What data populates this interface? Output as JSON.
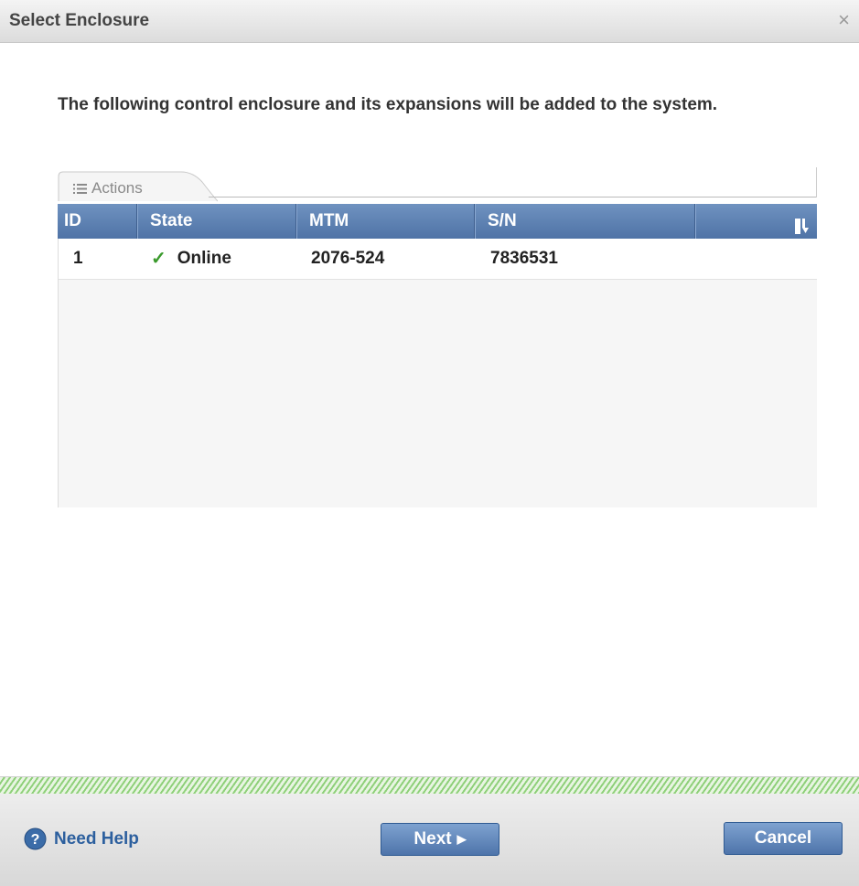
{
  "dialog": {
    "title": "Select Enclosure",
    "close_label": "×"
  },
  "intro_text": "The following control enclosure and its expansions will be added to the system.",
  "grid": {
    "actions_label": "Actions",
    "columns": [
      "ID",
      "State",
      "MTM",
      "S/N",
      ""
    ],
    "rows": [
      {
        "id": "1",
        "state": "Online",
        "state_icon": "check-icon",
        "mtm": "2076-524",
        "sn": "7836531"
      }
    ]
  },
  "footer": {
    "help_label": "Need Help",
    "next_label": "Next",
    "next_glyph": "▶",
    "cancel_label": "Cancel"
  },
  "colors": {
    "header_blue": "#5a7db0",
    "button_blue": "#4e74aa",
    "help_link": "#2c5f9e",
    "check_green": "#3a9a2c"
  }
}
